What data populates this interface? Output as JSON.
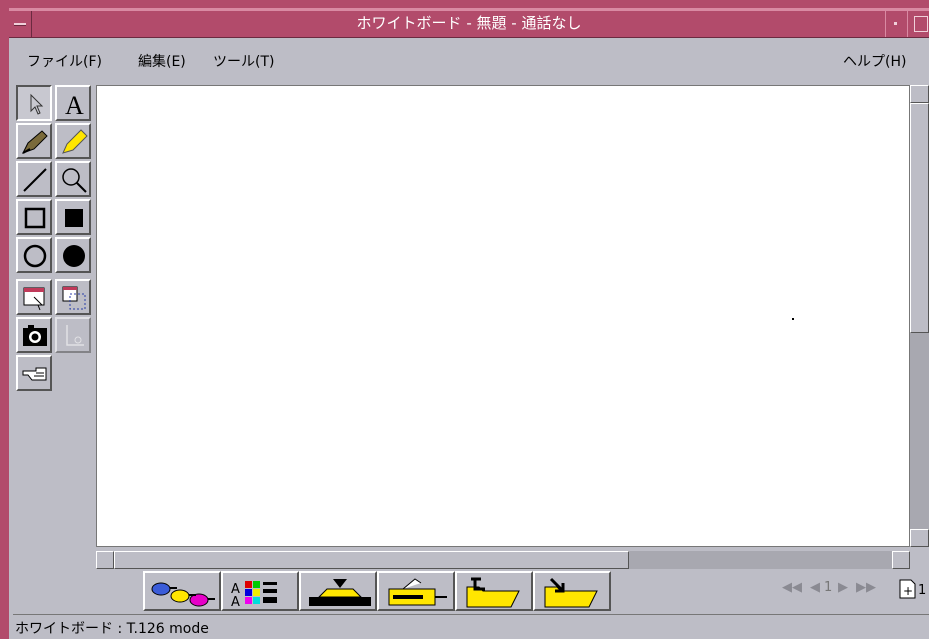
{
  "window": {
    "title": "ホワイトボード - 無題 - 通話なし"
  },
  "menu": {
    "file": "ファイル(F)",
    "edit": "編集(E)",
    "tools": "ツール(T)",
    "help": "ヘルプ(H)"
  },
  "tools": [
    "select-arrow",
    "text-tool",
    "pen-tool",
    "highlighter-tool",
    "line-tool",
    "zoom-tool",
    "rectangle-outline",
    "rectangle-filled",
    "ellipse-outline",
    "ellipse-filled",
    "select-window",
    "select-area",
    "camera-screenshot",
    "lock-contents",
    "remote-pointer"
  ],
  "bottom_toolbar": [
    "synchronize-button",
    "format-button",
    "insert-page-button",
    "send-page-button",
    "open-file-button",
    "save-file-button"
  ],
  "page_nav": {
    "current_page": "1"
  },
  "status": {
    "text": "ホワイトボード : T.126 mode"
  }
}
